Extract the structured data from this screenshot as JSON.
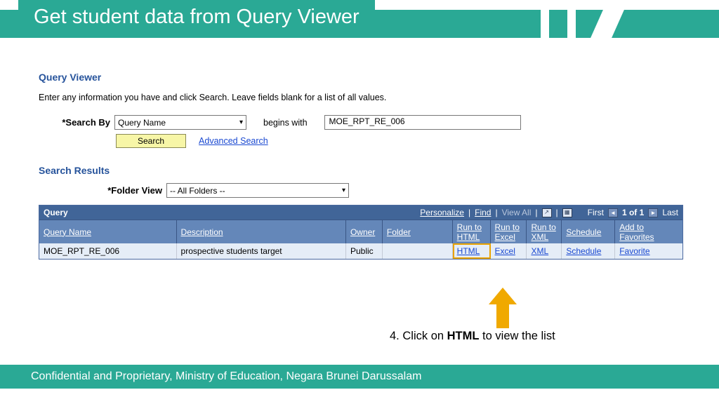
{
  "banner": {
    "title": "Get student data from Query Viewer"
  },
  "qv": {
    "heading": "Query Viewer",
    "instruction": "Enter any information you have and click Search. Leave fields blank for a list of all values.",
    "search_by_label": "*Search By",
    "search_by_value": "Query Name",
    "begins_with": "begins with",
    "search_text": "MOE_RPT_RE_006",
    "search_button": "Search",
    "advanced_search": "Advanced Search"
  },
  "sr": {
    "heading": "Search Results",
    "folder_label": "*Folder View",
    "folder_value": "-- All Folders --"
  },
  "grid": {
    "title": "Query",
    "toolbar": {
      "personalize": "Personalize",
      "find": "Find",
      "view_all": "View All",
      "first": "First",
      "counter": "1 of 1",
      "last": "Last"
    },
    "headers": {
      "query_name": "Query Name",
      "description": "Description",
      "owner": "Owner",
      "folder": "Folder",
      "run_html": "Run to HTML",
      "run_excel": "Run to Excel",
      "run_xml": "Run to XML",
      "schedule": "Schedule",
      "favorites": "Add to Favorites"
    },
    "row": {
      "query_name": "MOE_RPT_RE_006",
      "description": "prospective students target",
      "owner": "Public",
      "folder": "",
      "html": "HTML",
      "excel": "Excel",
      "xml": "XML",
      "schedule": "Schedule",
      "favorite": "Favorite"
    }
  },
  "callout": {
    "num": "4.",
    "pre": "Click on ",
    "bold": "HTML",
    "post": " to view the list"
  },
  "footer": {
    "text": "Confidential and Proprietary, Ministry of Education, Negara Brunei Darussalam"
  }
}
